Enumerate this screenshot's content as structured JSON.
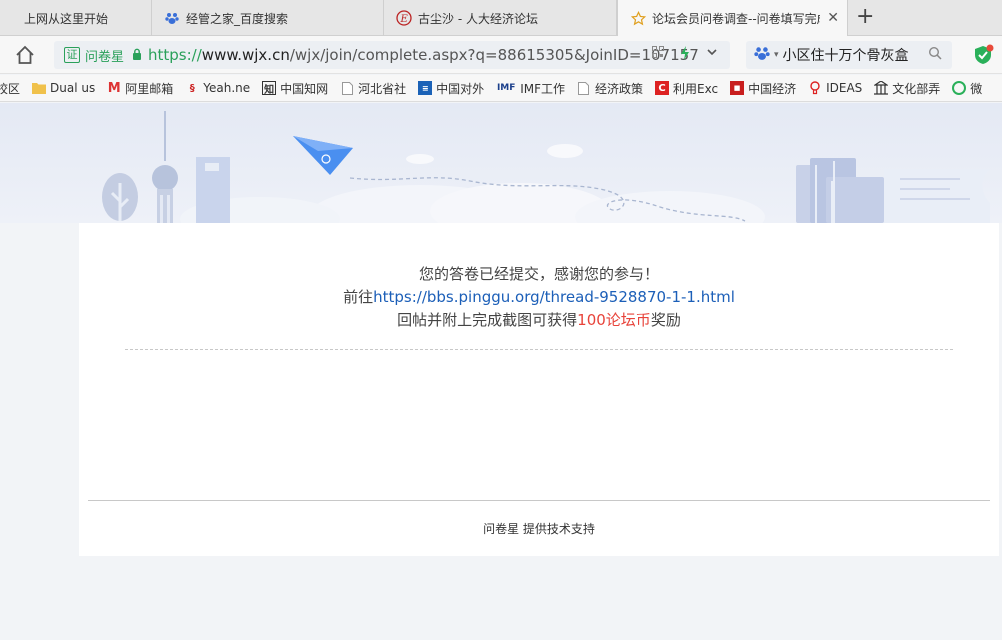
{
  "tabs": [
    {
      "title": "上网从这里开始",
      "icon": "page-icon"
    },
    {
      "title": "经管之家_百度搜索",
      "icon": "baidu-paw-icon"
    },
    {
      "title": "古尘沙 - 人大经济论坛",
      "icon": "pinggu-e-icon"
    },
    {
      "title": "论坛会员问卷调查--问卷填写完成",
      "icon": "star-icon"
    }
  ],
  "address_bar": {
    "cert_label": "证",
    "cert_name": "问卷星",
    "url_scheme": "https://",
    "url_host": "www.wjx.cn",
    "url_path": "/wjx/join/complete.aspx?q=88615305&JoinID=107157"
  },
  "search_bar": {
    "query": "小区住十万个骨灰盒"
  },
  "bookmarks": [
    {
      "label": "校区",
      "icon": "folder-icon"
    },
    {
      "label": "Dual us",
      "icon": "folder-icon"
    },
    {
      "label": "阿里邮箱",
      "icon": "aliyun-mail-icon"
    },
    {
      "label": "Yeah.ne",
      "icon": "yeah-icon"
    },
    {
      "label": "中国知网",
      "icon": "cnki-icon"
    },
    {
      "label": "河北省社",
      "icon": "page-icon"
    },
    {
      "label": "中国对外",
      "icon": "site-icon"
    },
    {
      "label": "IMF工作",
      "icon": "imf-icon"
    },
    {
      "label": "经济政策",
      "icon": "page-icon"
    },
    {
      "label": "利用Exc",
      "icon": "c-icon"
    },
    {
      "label": "中国经济",
      "icon": "red-site-icon"
    },
    {
      "label": "IDEAS",
      "icon": "bulb-icon"
    },
    {
      "label": "文化部弄",
      "icon": "building-icon"
    },
    {
      "label": "微",
      "icon": "wechat-icon"
    }
  ],
  "content": {
    "line1": "您的答卷已经提交，感谢您的参与！",
    "line2_prefix": "前往",
    "line2_link": "https://bbs.pinggu.org/thread-9528870-1-1.html",
    "line3_prefix": "回帖并附上完成截图可获得",
    "line3_reward": "100论坛币",
    "line3_suffix": "奖励"
  },
  "footer": {
    "text": "问卷星 提供技术支持"
  },
  "colors": {
    "accent_green": "#2aa05a",
    "link_blue": "#1c5fb8",
    "reward_red": "#e8433a"
  }
}
